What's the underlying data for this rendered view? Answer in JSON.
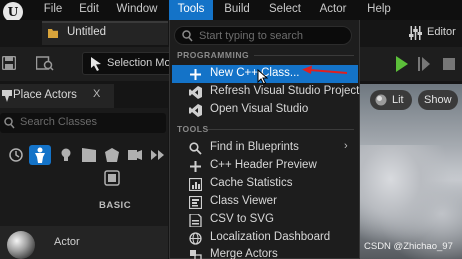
{
  "menubar": {
    "logo": "U",
    "items": [
      "File",
      "Edit",
      "Window",
      "Tools",
      "Build",
      "Select",
      "Actor",
      "Help"
    ],
    "active_index": 3
  },
  "tab": {
    "title": "Untitled"
  },
  "editor_button": {
    "label": "Editor"
  },
  "toolbar": {
    "selection_mode": "Selection Mo"
  },
  "place_actors": {
    "title": "Place Actors",
    "close": "X",
    "search_placeholder": "Search Classes",
    "category": "BASIC",
    "actor": "Actor"
  },
  "viewport": {
    "lit_label": "Lit",
    "show_label": "Show"
  },
  "tools_menu": {
    "search_placeholder": "Start typing to search",
    "sections": [
      {
        "label": "PROGRAMMING",
        "items": [
          {
            "label": "New C++ Class...",
            "icon": "plus-file-icon",
            "highlighted": true
          },
          {
            "label": "Refresh Visual Studio Project",
            "icon": "visual-studio-icon"
          },
          {
            "label": "Open Visual Studio",
            "icon": "visual-studio-icon"
          }
        ]
      },
      {
        "label": "TOOLS",
        "items": [
          {
            "label": "Find in Blueprints",
            "icon": "find-icon",
            "submenu": true
          },
          {
            "label": "C++ Header Preview",
            "icon": "cpp-header-icon"
          },
          {
            "label": "Cache Statistics",
            "icon": "statistics-icon"
          },
          {
            "label": "Class Viewer",
            "icon": "class-viewer-icon"
          },
          {
            "label": "CSV to SVG",
            "icon": "csv-icon"
          },
          {
            "label": "Localization Dashboard",
            "icon": "localization-icon"
          },
          {
            "label": "Merge Actors",
            "icon": "merge-actors-icon"
          }
        ]
      }
    ],
    "submenu_glyph": "›"
  },
  "watermark": "CSDN @Zhichao_97",
  "colors": {
    "menu_active": "#1473c8",
    "play_green": "#5cbf3a",
    "folder_yellow": "#d9a43b",
    "annotation_red": "#e02020"
  }
}
